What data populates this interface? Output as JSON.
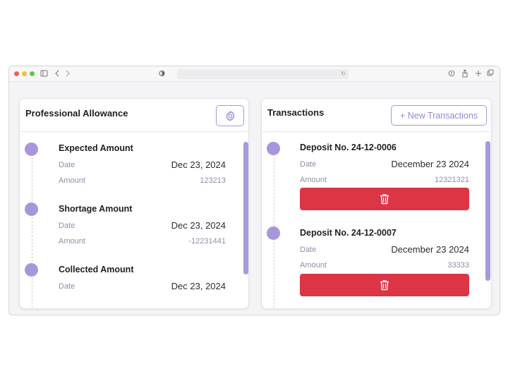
{
  "browser": {
    "traffic_lights": [
      "#ec5e57",
      "#f5be40",
      "#5fc54f"
    ]
  },
  "allowance": {
    "title": "Professional Allowance",
    "items": [
      {
        "title": "Expected Amount",
        "date_label": "Date",
        "date": "Dec 23, 2024",
        "amount_label": "Amount",
        "amount": "123213"
      },
      {
        "title": "Shortage Amount",
        "date_label": "Date",
        "date": "Dec 23, 2024",
        "amount_label": "Amount",
        "amount": "-12231441"
      },
      {
        "title": "Collected Amount",
        "date_label": "Date",
        "date": "Dec 23, 2024"
      }
    ]
  },
  "transactions": {
    "title": "Transactions",
    "new_button": "+ New Transactions",
    "items": [
      {
        "title": "Deposit No. 24-12-0006",
        "date_label": "Date",
        "date": "December 23 2024",
        "amount_label": "Amount",
        "amount": "12321321"
      },
      {
        "title": "Deposit No. 24-12-0007",
        "date_label": "Date",
        "date": "December 23 2024",
        "amount_label": "Amount",
        "amount": "33333"
      }
    ]
  },
  "colors": {
    "accent": "#a896dc",
    "danger": "#dc3545"
  }
}
